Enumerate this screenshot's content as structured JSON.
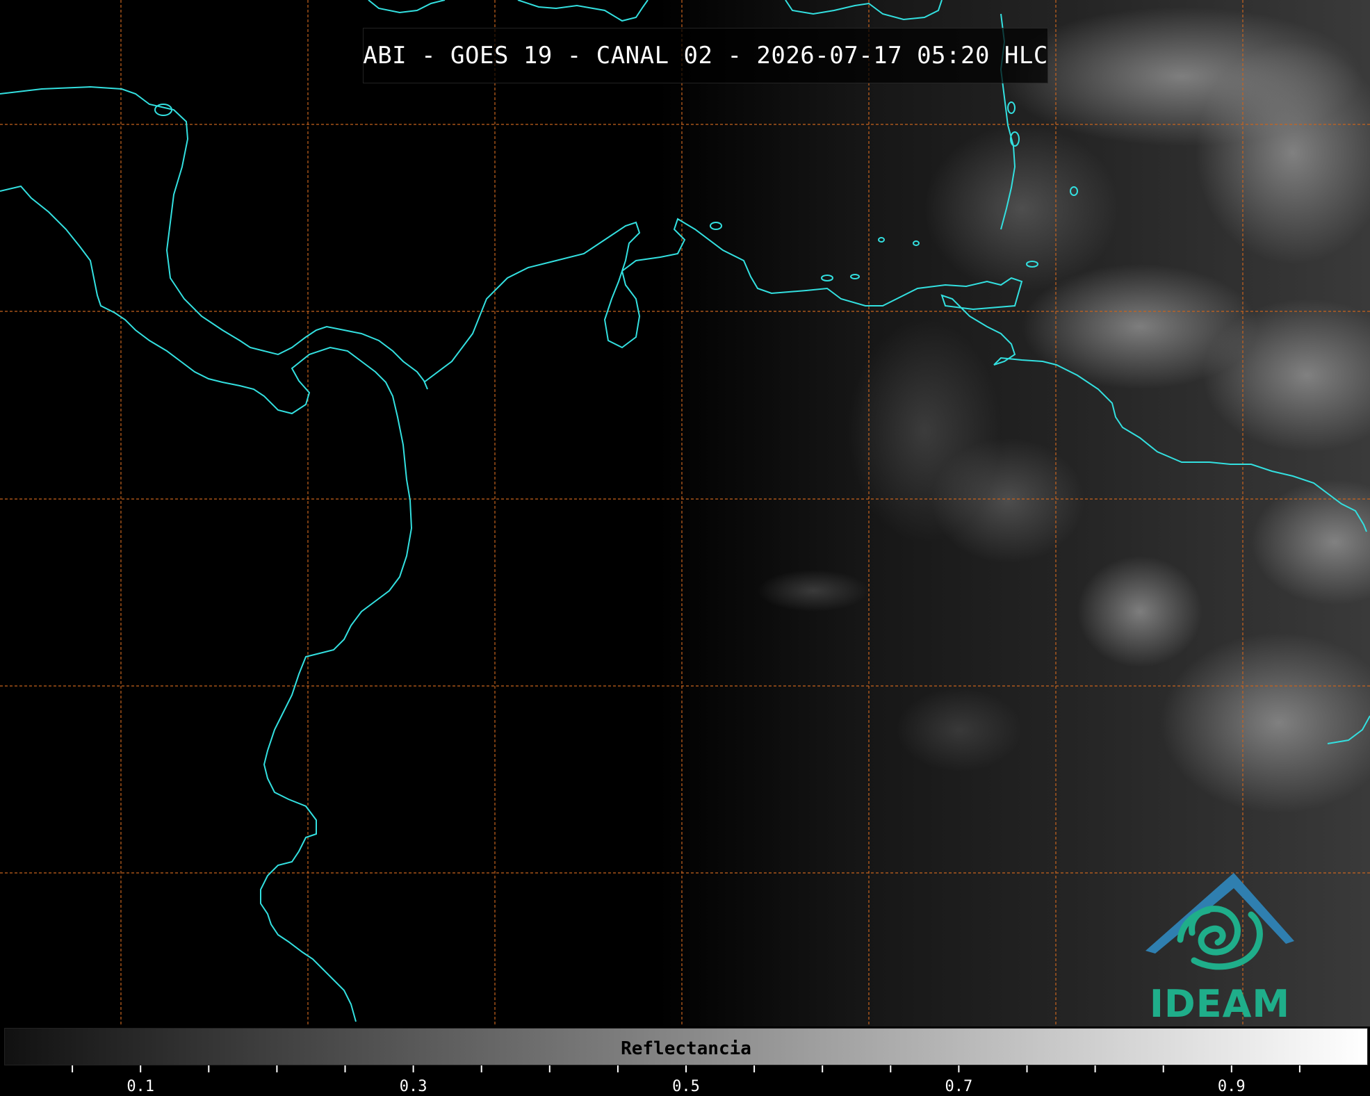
{
  "title": "ABI - GOES 19 - CANAL 02 - 2026-07-17 05:20 HLC",
  "colorbar": {
    "label": "Reflectancia",
    "ticks": [
      "0.1",
      "0.3",
      "0.5",
      "0.7",
      "0.9"
    ],
    "range": [
      0,
      1
    ],
    "gradient_from": "#111111",
    "gradient_to": "#ffffff"
  },
  "logo": {
    "text": "IDEAM",
    "roof_color": "#2f7fb0",
    "swirl_color": "#1fae8a"
  },
  "map": {
    "coastline_color": "#33e0e0",
    "grid_color": "#c8641e",
    "background_color": "#000000"
  }
}
